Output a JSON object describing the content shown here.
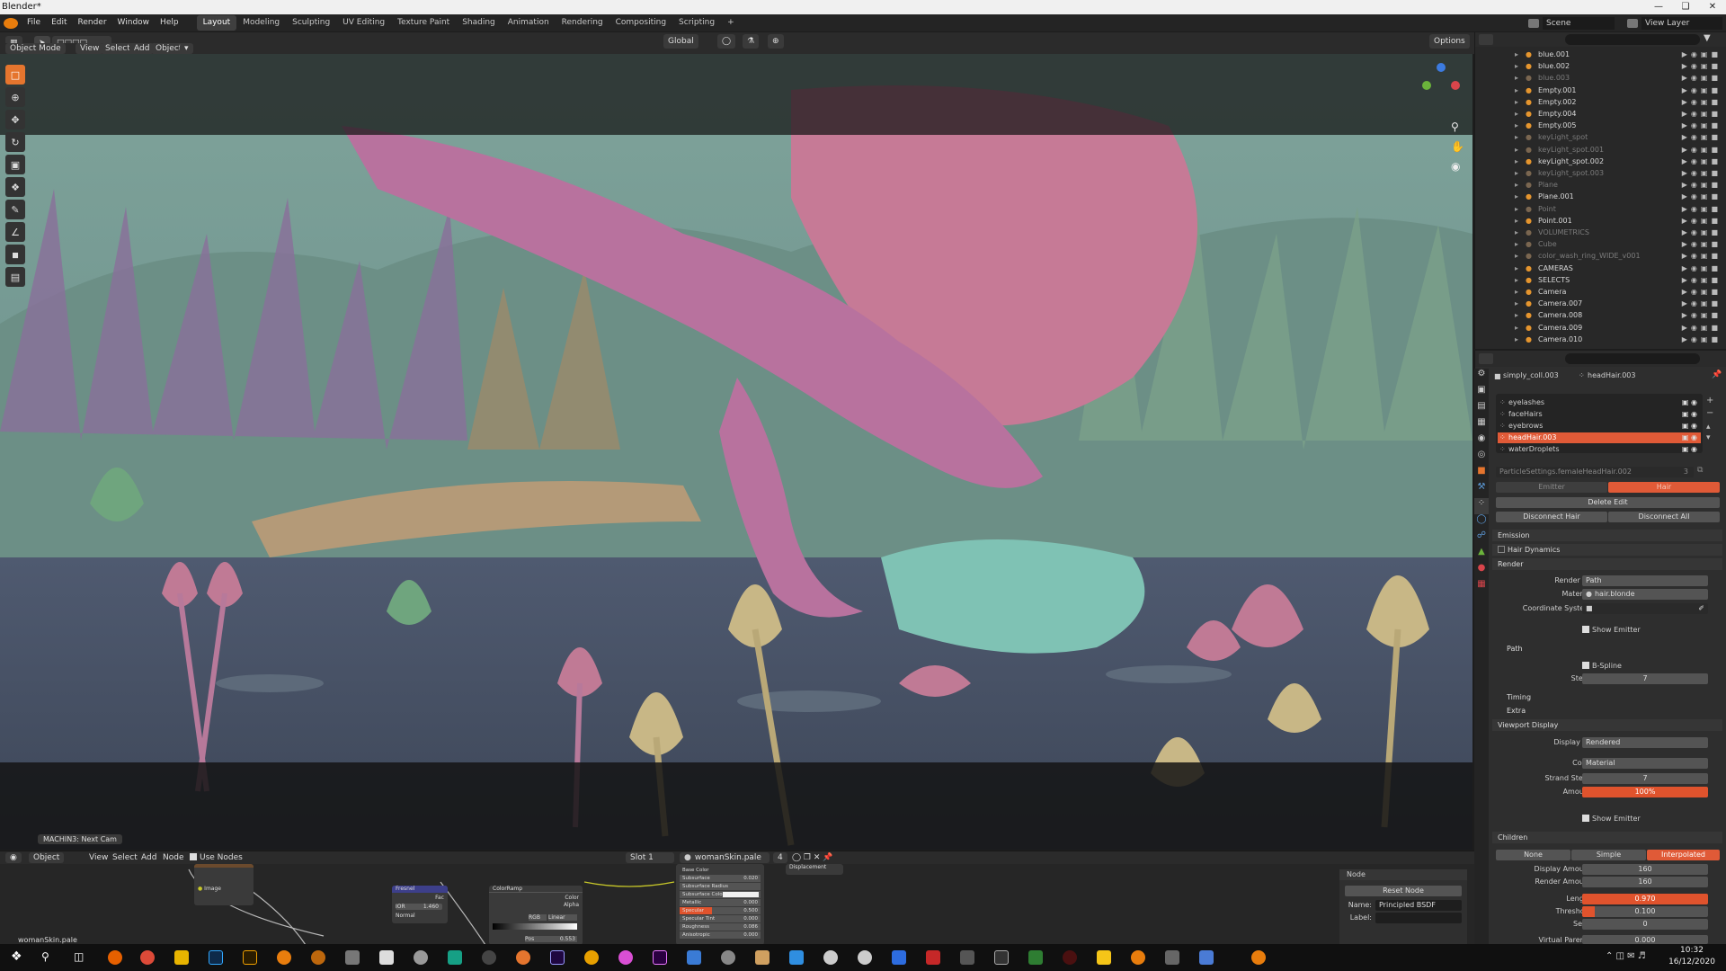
{
  "window": {
    "title": "Blender*"
  },
  "menu": [
    "File",
    "Edit",
    "Render",
    "Window",
    "Help"
  ],
  "workspaces": [
    "Layout",
    "Modeling",
    "Sculpting",
    "UV Editing",
    "Texture Paint",
    "Shading",
    "Animation",
    "Rendering",
    "Compositing",
    "Scripting"
  ],
  "active_workspace": "Layout",
  "top_right": {
    "scene": "Scene",
    "view_layer": "View Layer"
  },
  "viewport_header": {
    "mode": "Object Mode",
    "menus": [
      "View",
      "Select",
      "Add",
      "Object"
    ],
    "transform": "Global",
    "options": "Options"
  },
  "viewport": {
    "status_overlay": "MACHIN3: Next Cam"
  },
  "outliner": {
    "rows": [
      {
        "name": "blue.001",
        "dim": false
      },
      {
        "name": "blue.002",
        "dim": false
      },
      {
        "name": "blue.003",
        "dim": true
      },
      {
        "name": "Empty.001",
        "dim": false
      },
      {
        "name": "Empty.002",
        "dim": false
      },
      {
        "name": "Empty.004",
        "dim": false
      },
      {
        "name": "Empty.005",
        "dim": false
      },
      {
        "name": "keyLight_spot",
        "dim": true
      },
      {
        "name": "keyLight_spot.001",
        "dim": true
      },
      {
        "name": "keyLight_spot.002",
        "dim": false
      },
      {
        "name": "keyLight_spot.003",
        "dim": true
      },
      {
        "name": "Plane",
        "dim": true
      },
      {
        "name": "Plane.001",
        "dim": false
      },
      {
        "name": "Point",
        "dim": true
      },
      {
        "name": "Point.001",
        "dim": false
      },
      {
        "name": "VOLUMETRICS",
        "dim": true
      },
      {
        "name": "Cube",
        "dim": true
      },
      {
        "name": "color_wash_ring_WIDE_v001",
        "dim": true
      },
      {
        "name": "CAMERAS",
        "dim": false
      },
      {
        "name": "SELECTS",
        "dim": false
      },
      {
        "name": "Camera",
        "dim": false
      },
      {
        "name": "Camera.007",
        "dim": false
      },
      {
        "name": "Camera.008",
        "dim": false
      },
      {
        "name": "Camera.009",
        "dim": false
      },
      {
        "name": "Camera.010",
        "dim": false
      }
    ]
  },
  "properties": {
    "breadcrumb_object": "simply_coll.003",
    "breadcrumb_item": "headHair.003",
    "particle_systems": [
      "eyelashes",
      "faceHairs",
      "eyebrows",
      "headHair.003",
      "waterDroplets"
    ],
    "active_system": "headHair.003",
    "settings_name": "ParticleSettings.femaleHeadHair.002",
    "settings_users": "3",
    "type_emitter": "Emitter",
    "type_hair": "Hair",
    "delete_edit": "Delete Edit",
    "disconnect_hair": "Disconnect Hair",
    "disconnect_all": "Disconnect All",
    "sections": {
      "emission": "Emission",
      "hair_dynamics": "Hair Dynamics",
      "render": "Render",
      "path": "Path",
      "timing": "Timing",
      "extra": "Extra",
      "viewport_display": "Viewport Display",
      "children": "Children"
    },
    "render": {
      "render_as_label": "Render As",
      "render_as": "Path",
      "material_label": "Material",
      "material": "hair.blonde",
      "coord_label": "Coordinate System",
      "show_emitter": "Show Emitter",
      "bspline": "B-Spline",
      "steps_label": "Steps",
      "steps": "7"
    },
    "viewport_display": {
      "display_as_label": "Display As",
      "display_as": "Rendered",
      "color_label": "Color",
      "color": "Material",
      "strand_steps_label": "Strand Steps",
      "strand_steps": "7",
      "amount_label": "Amount",
      "amount": "100%",
      "show_emitter": "Show Emitter"
    },
    "children": {
      "none": "None",
      "simple": "Simple",
      "interpolated": "Interpolated",
      "display_amount_label": "Display Amount",
      "display_amount": "160",
      "render_amount_label": "Render Amount",
      "render_amount": "160",
      "length_label": "Length",
      "length": "0.970",
      "threshold_label": "Threshold",
      "threshold": "0.100",
      "seed_label": "Seed",
      "seed": "0",
      "virtual_parents_label": "Virtual Parents",
      "virtual_parents": "0.000"
    }
  },
  "node_editor": {
    "type": "Object",
    "menus": [
      "View",
      "Select",
      "Add",
      "Node"
    ],
    "use_nodes": "Use Nodes",
    "slot": "Slot 1",
    "material": "womanSkin.pale",
    "users": "4",
    "footer_name": "womanSkin.pale",
    "nodes": {
      "image": "Image",
      "fresnel": "Fresnel",
      "fresnel_fac": "Fac",
      "fresnel_ior_label": "IOR",
      "fresnel_ior": "1.460",
      "fresnel_normal": "Normal",
      "colorramp": "ColorRamp",
      "cr_color": "Color",
      "cr_alpha": "Alpha",
      "cr_rgb": "RGB",
      "cr_linear": "Linear",
      "cr_pos": "Pos",
      "cr_pos_val": "0.553",
      "displacement": "Displacement",
      "bsdf_rows": [
        {
          "label": "Base Color",
          "value": ""
        },
        {
          "label": "Subsurface",
          "value": "0.020"
        },
        {
          "label": "Subsurface Radius",
          "value": ""
        },
        {
          "label": "Subsurface Color",
          "value": ""
        },
        {
          "label": "Metallic",
          "value": "0.000"
        },
        {
          "label": "Specular",
          "value": "0.500"
        },
        {
          "label": "Specular Tint",
          "value": "0.000"
        },
        {
          "label": "Roughness",
          "value": "0.086"
        },
        {
          "label": "Anisotropic",
          "value": "0.000"
        }
      ]
    },
    "sidebar": {
      "section": "Node",
      "reset": "Reset Node",
      "name_label": "Name:",
      "name": "Principled BSDF",
      "label_label": "Label:"
    }
  },
  "taskbar": {
    "time": "10:32",
    "date": "16/12/2020"
  },
  "colors": {
    "accent": "#e5752e",
    "active_row": "#e05a37",
    "amount_bar": "#e0532d"
  }
}
